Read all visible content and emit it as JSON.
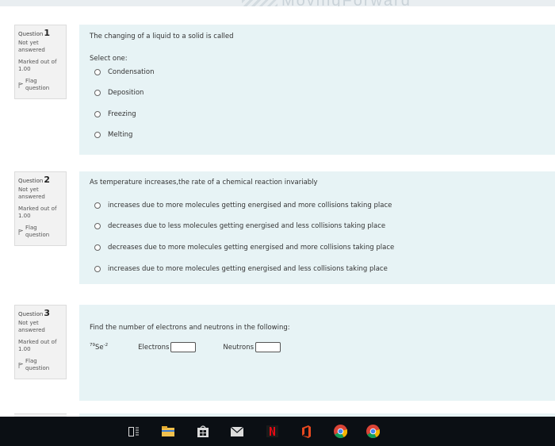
{
  "banner": {
    "watermark_text": "MovingForward"
  },
  "questions": [
    {
      "label": "Question",
      "number": "1",
      "state": "Not yet answered",
      "marks": "Marked out of 1.00",
      "flag_label": "Flag question",
      "text": "The changing of a liquid to a solid is called",
      "prompt": "Select one:",
      "options": [
        "Condensation",
        "Deposition",
        "Freezing",
        "Melting"
      ]
    },
    {
      "label": "Question",
      "number": "2",
      "state": "Not yet answered",
      "marks": "Marked out of 1.00",
      "flag_label": "Flag question",
      "text": "As temperature increases,the rate of a chemical reaction invariably",
      "options": [
        "increases due to more molecules getting energised and more collisions taking place",
        "decreases due to less molecules getting energised and less collisions taking place",
        "decreases due to more molecules getting energised and more collisions taking place",
        "increases due to more molecules getting energised and less collisions taking place"
      ]
    },
    {
      "label": "Question",
      "number": "3",
      "state": "Not yet answered",
      "marks": "Marked out of 1.00",
      "flag_label": "Flag question",
      "text": "Find the number of electrons and neutrons in the following:",
      "isotope_mass": "79",
      "isotope_symbol": "Se",
      "isotope_charge": "-2",
      "electrons_label": "Electrons",
      "neutrons_label": "Neutrons",
      "electrons_value": "",
      "neutrons_value": ""
    }
  ],
  "taskbar": {
    "icons": [
      "task-view-icon",
      "file-explorer-icon",
      "store-icon",
      "mail-icon",
      "netflix-icon",
      "office-icon",
      "chrome-icon",
      "chrome-icon"
    ]
  },
  "colors": {
    "content_bg": "#e7f3f5",
    "info_bg": "#f2f2f2",
    "taskbar_bg": "#0b0f14"
  }
}
